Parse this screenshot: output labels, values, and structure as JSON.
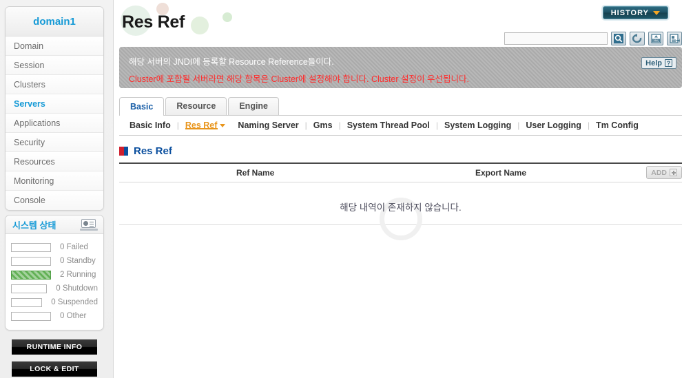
{
  "sidebar": {
    "domain_label": "domain1",
    "nav": [
      {
        "label": "Domain",
        "active": false
      },
      {
        "label": "Session",
        "active": false
      },
      {
        "label": "Clusters",
        "active": false
      },
      {
        "label": "Servers",
        "active": true
      },
      {
        "label": "Applications",
        "active": false
      },
      {
        "label": "Security",
        "active": false
      },
      {
        "label": "Resources",
        "active": false
      },
      {
        "label": "Monitoring",
        "active": false
      },
      {
        "label": "Console",
        "active": false
      }
    ],
    "status": {
      "title": "시스템 상태",
      "icon": "laptop-chart-icon",
      "rows": [
        {
          "count": "0",
          "label": "Failed",
          "filled": false
        },
        {
          "count": "0",
          "label": "Standby",
          "filled": false
        },
        {
          "count": "2",
          "label": "Running",
          "filled": true
        },
        {
          "count": "0",
          "label": "Shutdown",
          "filled": false
        },
        {
          "count": "0",
          "label": "Suspended",
          "filled": false
        },
        {
          "count": "0",
          "label": "Other",
          "filled": false
        }
      ],
      "fill_color": "#63b156"
    },
    "buttons": {
      "runtime_info": "RUNTIME INFO",
      "lock_edit": "LOCK & EDIT"
    }
  },
  "header": {
    "page_title": "Res Ref",
    "history_label": "HISTORY",
    "search_value": "",
    "search_placeholder": "",
    "tools": [
      {
        "name": "search-icon"
      },
      {
        "name": "refresh-icon"
      },
      {
        "name": "export-xml-icon"
      },
      {
        "name": "export-report-icon"
      }
    ]
  },
  "notice": {
    "line1": "해당 서버의 JNDI에 등록할 Resource Reference들이다.",
    "line2": "Cluster에 포함될 서버라면 해당 항목은 Cluster에 설정해야 합니다. Cluster 설정이 우선됩니다.",
    "help_label": "Help",
    "help_mark": "?",
    "line2_color": "#ff2b2b"
  },
  "tabs": [
    {
      "label": "Basic",
      "active": true
    },
    {
      "label": "Resource",
      "active": false
    },
    {
      "label": "Engine",
      "active": false
    }
  ],
  "subnav": [
    {
      "label": "Basic Info",
      "active": false
    },
    {
      "label": "Res Ref",
      "active": true
    },
    {
      "label": "Naming Server",
      "active": false
    },
    {
      "label": "Gms",
      "active": false
    },
    {
      "label": "System Thread Pool",
      "active": false
    },
    {
      "label": "System Logging",
      "active": false
    },
    {
      "label": "User Logging",
      "active": false
    },
    {
      "label": "Tm Config",
      "active": false
    }
  ],
  "section": {
    "icon": "four-square-icon",
    "title": "Res Ref",
    "accent_color": "#0b4f9e"
  },
  "table": {
    "columns": [
      "Ref Name",
      "Export Name"
    ],
    "add_label": "ADD",
    "add_disabled": true,
    "rows": [],
    "empty_message": "해당 내역이 존재하지 않습니다."
  }
}
